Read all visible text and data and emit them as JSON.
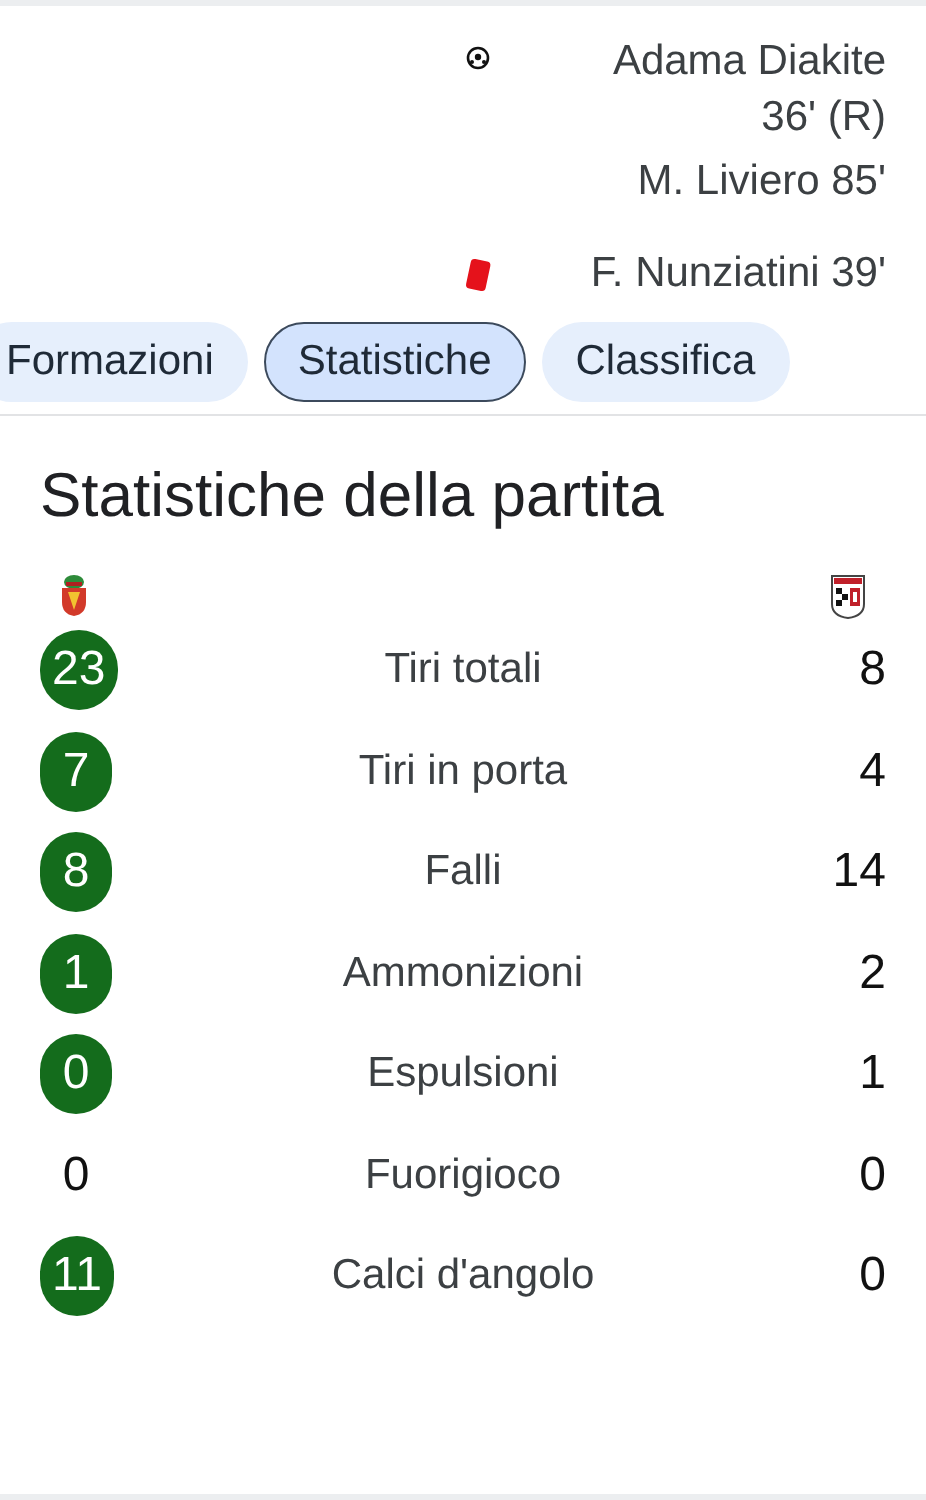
{
  "events": [
    {
      "kind": "goal",
      "lines": [
        "Adama Diakite 36' (R)",
        "M. Liviero 85'"
      ]
    },
    {
      "kind": "red_card",
      "lines": [
        "F. Nunziatini 39'"
      ]
    }
  ],
  "tabs": [
    {
      "label": "Formazioni",
      "selected": false
    },
    {
      "label": "Statistiche",
      "selected": true
    },
    {
      "label": "Classifica",
      "selected": false
    }
  ],
  "stats": {
    "title": "Statistiche della partita",
    "rows": [
      {
        "home": "23",
        "label": "Tiri totali",
        "away": "8",
        "home_leads": true
      },
      {
        "home": "7",
        "label": "Tiri in porta",
        "away": "4",
        "home_leads": true
      },
      {
        "home": "8",
        "label": "Falli",
        "away": "14",
        "home_leads": true
      },
      {
        "home": "1",
        "label": "Ammonizioni",
        "away": "2",
        "home_leads": true
      },
      {
        "home": "0",
        "label": "Espulsioni",
        "away": "1",
        "home_leads": true
      },
      {
        "home": "0",
        "label": "Fuorigioco",
        "away": "0",
        "home_leads": false
      },
      {
        "home": "11",
        "label": "Calci d'angolo",
        "away": "0",
        "home_leads": true
      }
    ]
  }
}
